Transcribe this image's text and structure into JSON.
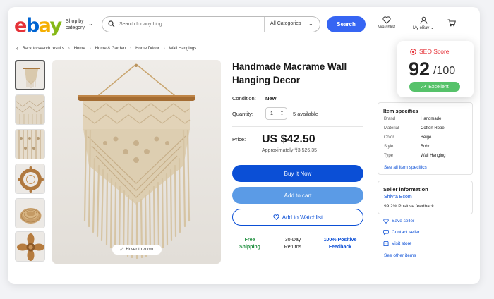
{
  "header": {
    "logo": [
      "e",
      "b",
      "a",
      "y"
    ],
    "shop_by": "Shop by category",
    "search_placeholder": "Search for anything",
    "category": "All Categories",
    "search_button": "Search",
    "watchlist": "Watchlist",
    "my_ebay": "My eBay"
  },
  "breadcrumb": {
    "back": "Back to search results",
    "items": [
      "Home",
      "Home & Garden",
      "Home Décor",
      "Wall Hangings"
    ]
  },
  "gallery": {
    "hover_zoom": "Hover to zoom"
  },
  "product": {
    "title": "Handmade Macrame Wall Hanging Decor",
    "condition_label": "Condition:",
    "condition_value": "New",
    "quantity_label": "Quantity:",
    "quantity_value": "1",
    "available": "5 available",
    "price_label": "Price:",
    "price": "US $42.50",
    "approx": "Approximately ₹3,526.35",
    "buy_now": "Buy It Now",
    "add_to_cart": "Add to cart",
    "add_to_watchlist": "Add to Watchlist",
    "features": [
      {
        "line1": "Free",
        "line2": "Shipping",
        "color": "#1e8e3e"
      },
      {
        "line1": "30-Day",
        "line2": "Returns",
        "color": "#191919"
      },
      {
        "line1": "100% Positive",
        "line2": "Feedback",
        "color": "#0b4fd6"
      }
    ]
  },
  "specifics": {
    "heading": "Item specifics",
    "rows": [
      {
        "k": "Brand",
        "v": "Handmade"
      },
      {
        "k": "Material",
        "v": "Cotton Rope"
      },
      {
        "k": "Color",
        "v": "Beige"
      },
      {
        "k": "Style",
        "v": "Boho"
      },
      {
        "k": "Type",
        "v": "Wall Hanging"
      }
    ],
    "see_all": "See all item specifics"
  },
  "seller": {
    "heading": "Seller information",
    "name": "Shivra Ecom",
    "feedback": "99.2% Positive feedback",
    "save": "Save seller",
    "contact": "Contact seller",
    "visit": "Visit store",
    "other": "See other items"
  },
  "seo": {
    "title": "SEO Score",
    "score": "92",
    "max": "/100",
    "badge": "Excellent",
    "accent": "#e53238",
    "badge_color": "#56c26a"
  }
}
